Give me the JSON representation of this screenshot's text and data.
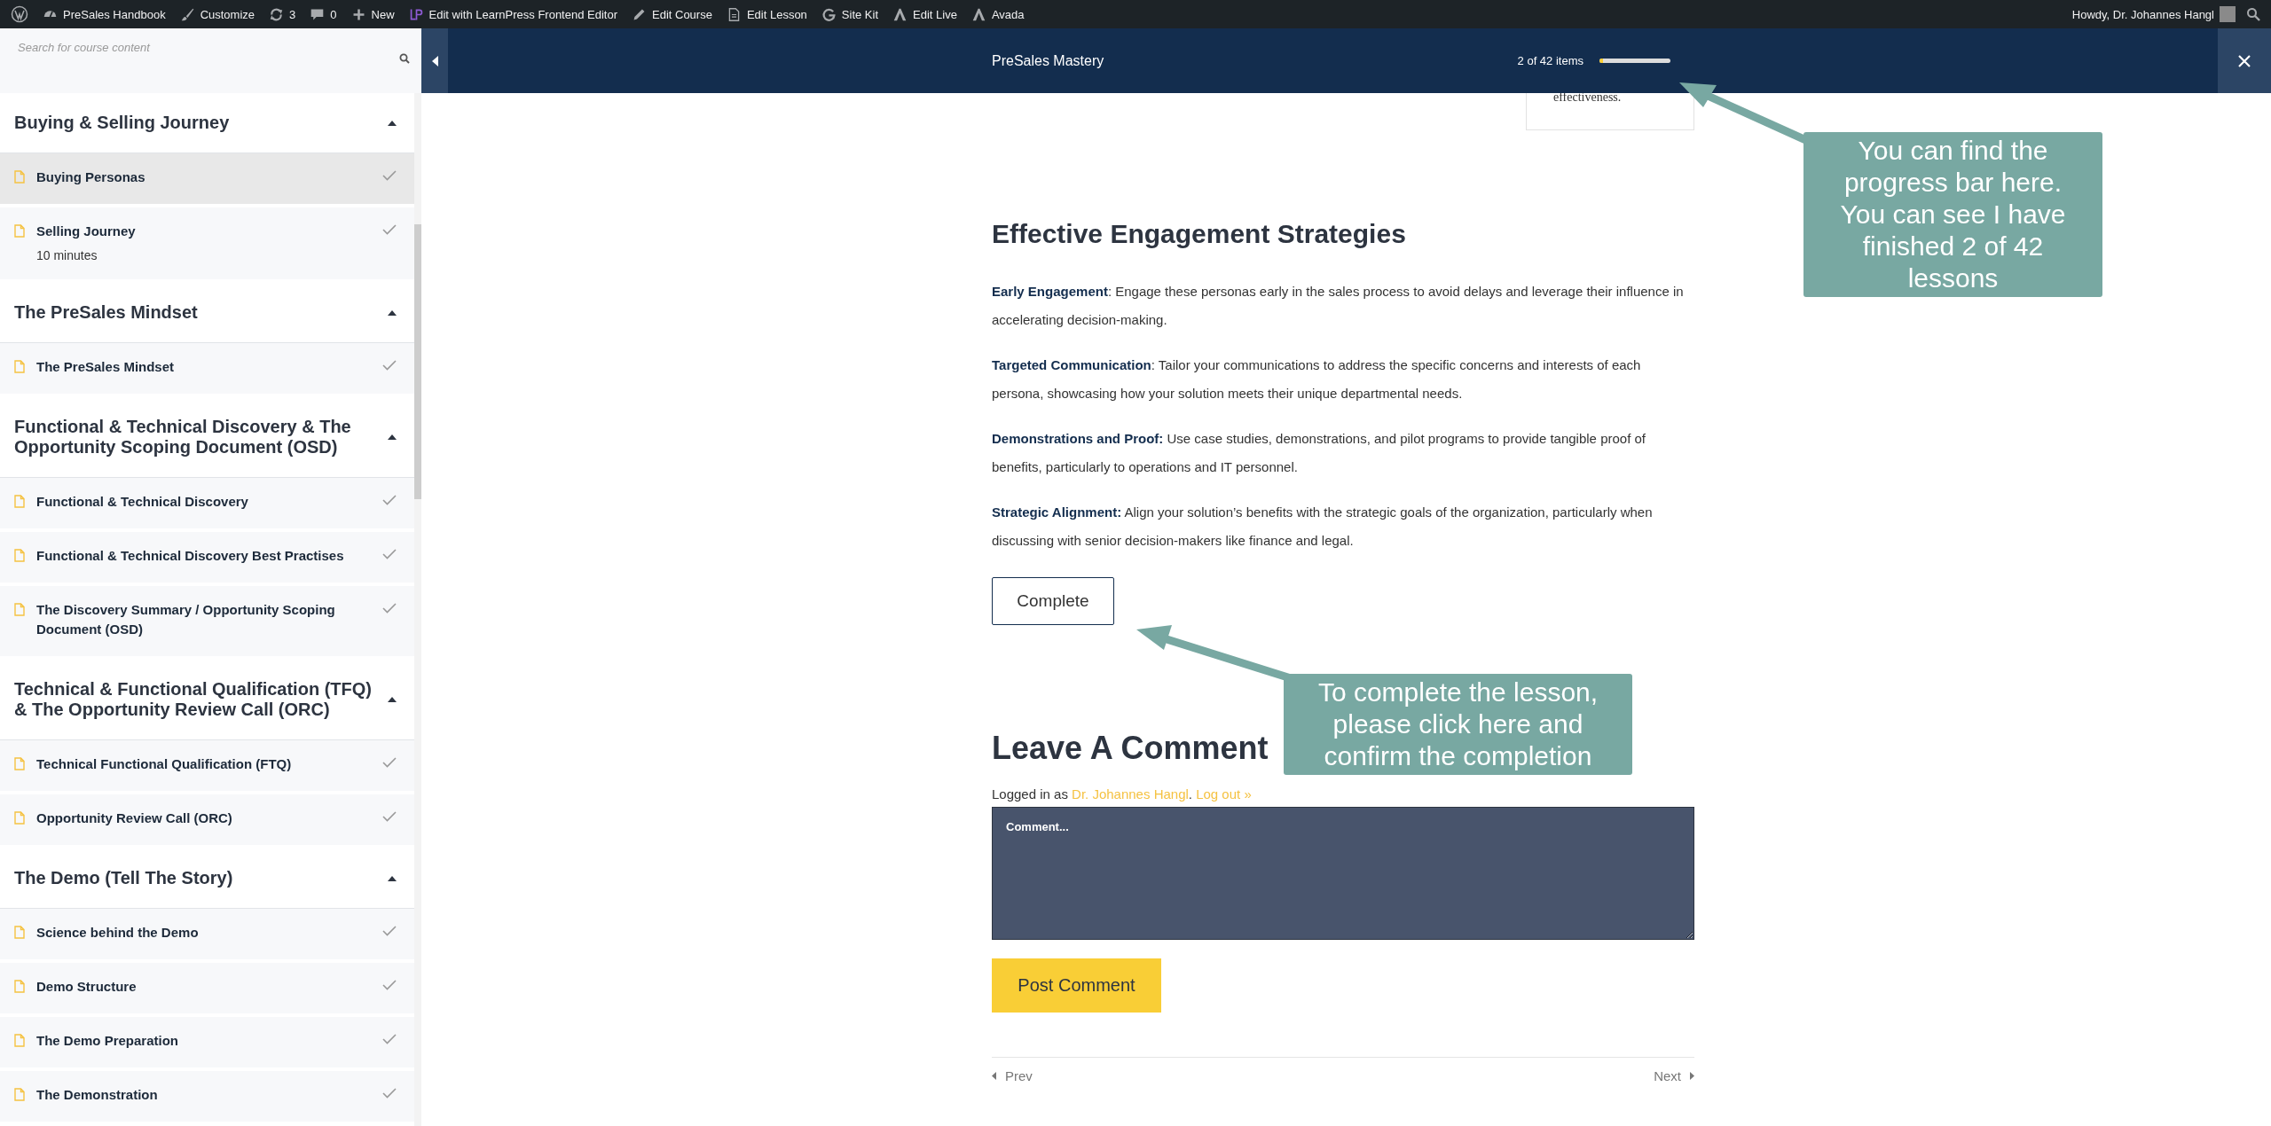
{
  "admin_bar": {
    "items": [
      {
        "label": "PreSales Handbook"
      },
      {
        "label": "Customize"
      },
      {
        "label": "3"
      },
      {
        "label": "0"
      },
      {
        "label": "New"
      },
      {
        "label": "Edit with LearnPress Frontend Editor"
      },
      {
        "label": "Edit Course"
      },
      {
        "label": "Edit Lesson"
      },
      {
        "label": "Site Kit"
      },
      {
        "label": "Edit Live"
      },
      {
        "label": "Avada"
      }
    ],
    "greeting": "Howdy, Dr. Johannes Hangl"
  },
  "sidebar": {
    "search_placeholder": "Search for course content",
    "sections": [
      {
        "title": "Buying & Selling Journey",
        "expanded": true,
        "items": [
          {
            "title": "Buying Personas",
            "selected": true,
            "completed": true
          },
          {
            "title": "Selling Journey",
            "duration": "10 minutes",
            "selected": false,
            "completed": true
          }
        ]
      },
      {
        "title": "The PreSales Mindset",
        "expanded": true,
        "items": [
          {
            "title": "The PreSales Mindset",
            "selected": false,
            "completed": true
          }
        ]
      },
      {
        "title": "Functional & Technical Discovery & The Opportunity Scoping Document (OSD)",
        "expanded": true,
        "items": [
          {
            "title": "Functional & Technical Discovery",
            "selected": false,
            "completed": true
          },
          {
            "title": "Functional & Technical Discovery Best Practises",
            "selected": false,
            "completed": true
          },
          {
            "title": "The Discovery Summary / Opportunity Scoping Document (OSD)",
            "selected": false,
            "completed": true
          }
        ]
      },
      {
        "title": "Technical & Functional Qualification (TFQ) & The Opportunity Review Call (ORC)",
        "expanded": true,
        "items": [
          {
            "title": "Technical Functional Qualification (FTQ)",
            "selected": false,
            "completed": true
          },
          {
            "title": "Opportunity Review Call (ORC)",
            "selected": false,
            "completed": true
          }
        ]
      },
      {
        "title": "The Demo (Tell The Story)",
        "expanded": true,
        "items": [
          {
            "title": "Science behind the Demo",
            "selected": false,
            "completed": true
          },
          {
            "title": "Demo Structure",
            "selected": false,
            "completed": true
          },
          {
            "title": "The Demo Preparation",
            "selected": false,
            "completed": true
          },
          {
            "title": "The Demonstration",
            "selected": false,
            "completed": true
          }
        ]
      }
    ]
  },
  "header": {
    "title": "PreSales Mastery",
    "progress_text": "2 of 42 items",
    "level": 0.05
  },
  "content": {
    "card_tail": "effectiveness.",
    "heading": "Effective Engagement Strategies",
    "paragraphs": [
      "**Early Engagement**: Engage these personas early in the sales process to avoid delays and leverage their influence in accelerating decision-making.",
      "**Targeted Communication**: Tailor your communications to address the specific concerns and interests of each persona, showcasing how your solution meets their unique departmental needs.",
      "**Demonstrations and Proof:** Use case studies, demonstrations, and pilot programs to provide tangible proof of benefits, particularly to operations and IT personnel.",
      "**Strategic Alignment:** Align your solution’s benefits with the strategic goals of the organization, particularly when discussing with senior decision-makers like finance and legal."
    ],
    "complete_button": "Complete",
    "comment_heading": "Leave A Comment",
    "logged_in": {
      "prefix": "Logged in as",
      "user": "Dr. Johannes Hangl",
      "separator": ".",
      "logout": "Log out »"
    },
    "comment_placeholder": "Comment...",
    "post_button": "Post Comment",
    "prev": "Prev",
    "next": "Next"
  },
  "annotations": [
    {
      "text": "You can find the progress bar here. You can see I have finished 2 of 42 lessons"
    },
    {
      "text": "To complete the lesson, please click here and confirm the completion"
    }
  ]
}
